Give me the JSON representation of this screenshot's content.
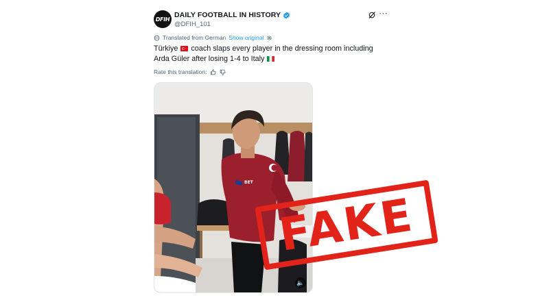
{
  "author": {
    "display_name": "DAILY FOOTBALL IN HISTORY",
    "handle": "@DFIH_101",
    "avatar_text": "DFIH",
    "verified": true
  },
  "header_icons": [
    "grok-icon",
    "more-icon"
  ],
  "translation": {
    "note": "Translated from German",
    "show_original": "Show original"
  },
  "tweet": {
    "text_part1": "Türkiye",
    "text_part2": "coach slaps every player in the dressing room including Arda Güler after losing 1-4 to Italy",
    "flags": [
      "turkey-flag",
      "italy-flag"
    ]
  },
  "rate": {
    "label": "Rate this translation:"
  },
  "media": {
    "jersey_text": "BET",
    "volume_icon": "volume-icon"
  },
  "stamp": {
    "text": "FAKE",
    "color": "#e2231a"
  },
  "colors": {
    "accent": "#1d9bf0",
    "text": "#0f1419",
    "muted": "#536471"
  }
}
